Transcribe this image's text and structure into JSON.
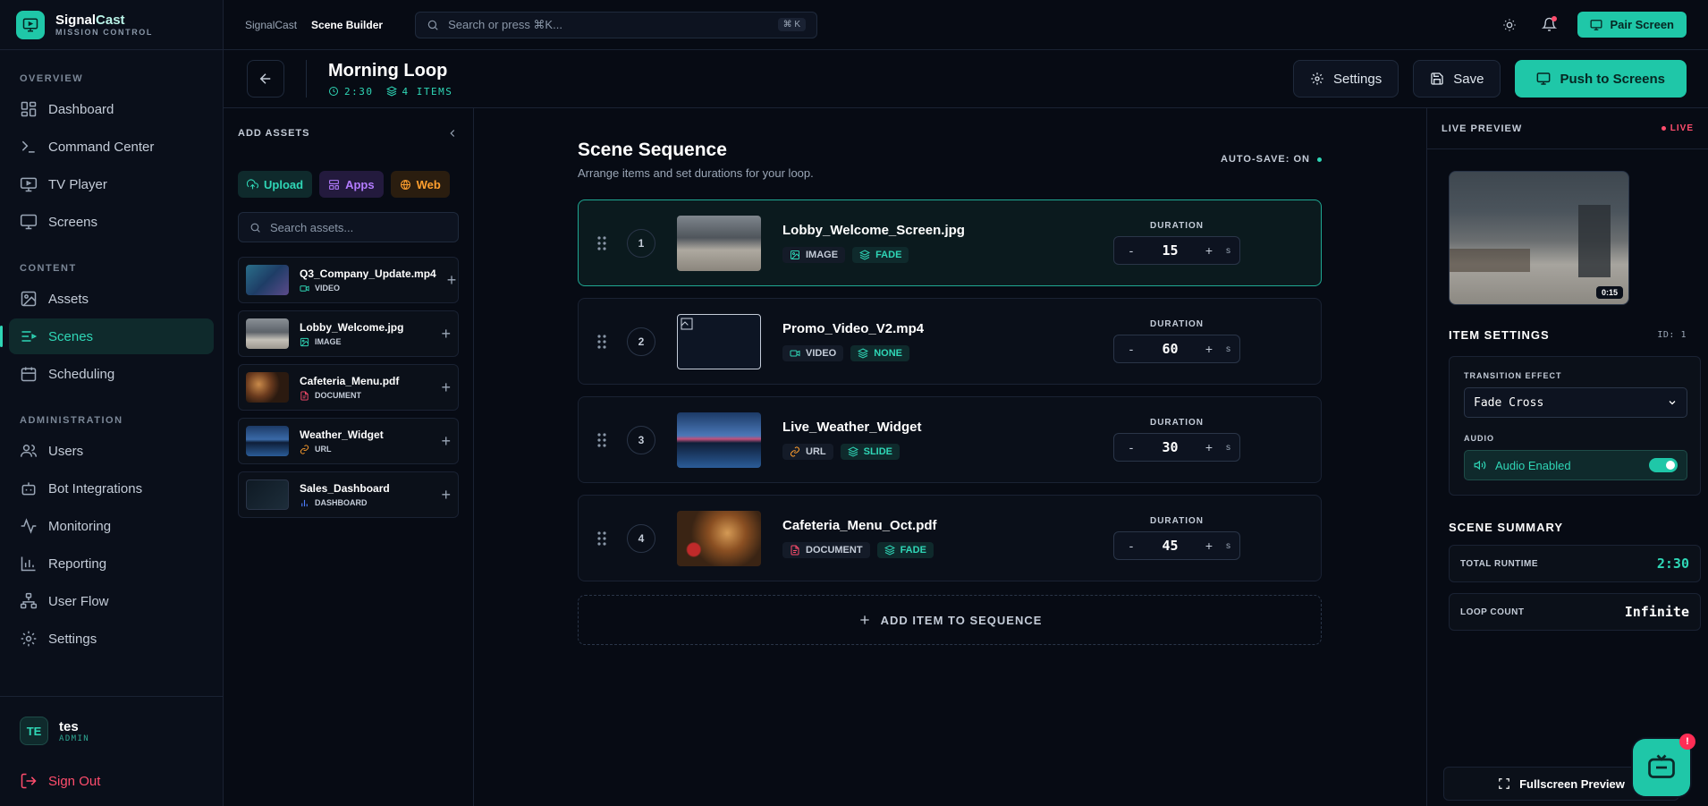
{
  "brand": {
    "name_main": "Signal",
    "name_accent": "Cast",
    "subtitle": "MISSION CONTROL"
  },
  "nav": {
    "overview_label": "OVERVIEW",
    "content_label": "CONTENT",
    "admin_label": "ADMINISTRATION",
    "items": [
      {
        "label": "Dashboard",
        "icon": "dashboard-icon"
      },
      {
        "label": "Command Center",
        "icon": "terminal-icon"
      },
      {
        "label": "TV Player",
        "icon": "tv-icon"
      },
      {
        "label": "Screens",
        "icon": "monitor-icon"
      },
      {
        "label": "Assets",
        "icon": "image-icon"
      },
      {
        "label": "Scenes",
        "icon": "list-icon",
        "active": true
      },
      {
        "label": "Scheduling",
        "icon": "calendar-icon"
      },
      {
        "label": "Users",
        "icon": "users-icon"
      },
      {
        "label": "Bot Integrations",
        "icon": "bot-icon"
      },
      {
        "label": "Monitoring",
        "icon": "activity-icon"
      },
      {
        "label": "Reporting",
        "icon": "bar-chart-icon"
      },
      {
        "label": "User Flow",
        "icon": "flow-icon"
      },
      {
        "label": "Settings",
        "icon": "gear-icon"
      }
    ]
  },
  "user": {
    "initials": "TE",
    "name": "tes",
    "role": "ADMIN",
    "signout": "Sign Out"
  },
  "topbar": {
    "crumb_root": "SignalCast",
    "crumb_current": "Scene Builder",
    "search_placeholder": "Search or press ⌘K...",
    "search_kbd": "⌘ K",
    "pair_label": "Pair Screen"
  },
  "scene": {
    "title": "Morning Loop",
    "duration": "2:30",
    "items_count": "4 ITEMS",
    "settings_label": "Settings",
    "save_label": "Save",
    "push_label": "Push to Screens"
  },
  "assets": {
    "header": "ADD ASSETS",
    "tabs": {
      "upload": "Upload",
      "apps": "Apps",
      "web": "Web"
    },
    "search_placeholder": "Search assets...",
    "list": [
      {
        "name": "Q3_Company_Update.mp4",
        "type": "VIDEO"
      },
      {
        "name": "Lobby_Welcome.jpg",
        "type": "IMAGE"
      },
      {
        "name": "Cafeteria_Menu.pdf",
        "type": "DOCUMENT"
      },
      {
        "name": "Weather_Widget",
        "type": "URL"
      },
      {
        "name": "Sales_Dashboard",
        "type": "DASHBOARD"
      }
    ]
  },
  "sequence": {
    "title": "Scene Sequence",
    "subtitle": "Arrange items and set durations for your loop.",
    "autosave": "AUTO-SAVE: ON",
    "duration_label": "DURATION",
    "unit": "s",
    "minus": "-",
    "plus": "+",
    "add_label": "ADD ITEM TO SEQUENCE",
    "items": [
      {
        "num": "1",
        "name": "Lobby_Welcome_Screen.jpg",
        "type": "IMAGE",
        "transition": "FADE",
        "duration": "15"
      },
      {
        "num": "2",
        "name": "Promo_Video_V2.mp4",
        "type": "VIDEO",
        "transition": "NONE",
        "duration": "60"
      },
      {
        "num": "3",
        "name": "Live_Weather_Widget",
        "type": "URL",
        "transition": "SLIDE",
        "duration": "30"
      },
      {
        "num": "4",
        "name": "Cafeteria_Menu_Oct.pdf",
        "type": "DOCUMENT",
        "transition": "FADE",
        "duration": "45"
      }
    ]
  },
  "preview": {
    "header": "LIVE PREVIEW",
    "live": "LIVE",
    "time": "0:15",
    "fullscreen": "Fullscreen Preview"
  },
  "item_settings": {
    "title": "ITEM SETTINGS",
    "id": "ID: 1",
    "transition_label": "TRANSITION EFFECT",
    "transition_value": "Fade Cross",
    "audio_label": "AUDIO",
    "audio_value": "Audio Enabled"
  },
  "summary": {
    "title": "SCENE SUMMARY",
    "runtime_label": "TOTAL RUNTIME",
    "runtime_value": "2:30",
    "loop_label": "LOOP COUNT",
    "loop_value": "Infinite"
  },
  "chat": {
    "badge": "!"
  },
  "colors": {
    "accent": "#1fc7a8",
    "danger": "#ff4d6d",
    "purple": "#b37cff",
    "orange": "#ff9f2e",
    "background": "#070b14"
  }
}
